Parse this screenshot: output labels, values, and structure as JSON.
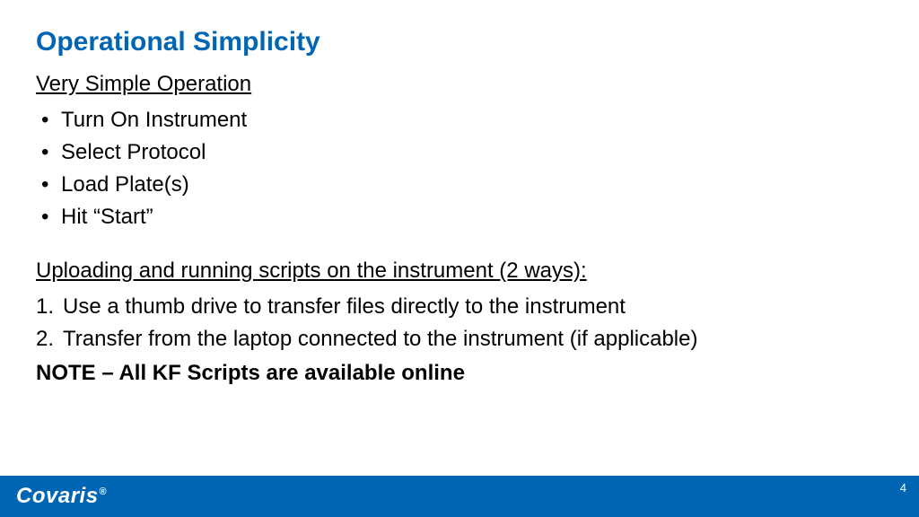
{
  "title": "Operational Simplicity",
  "section1": {
    "heading": "Very Simple Operation",
    "items": [
      "Turn On Instrument",
      "Select Protocol",
      "Load Plate(s)",
      "Hit “Start”"
    ]
  },
  "section2": {
    "heading": "Uploading and running scripts on the instrument (2 ways):",
    "items": [
      "Use a thumb drive to transfer files directly to the instrument",
      "Transfer from the laptop connected to the instrument (if applicable)"
    ]
  },
  "note": "NOTE – All KF Scripts are available online",
  "footer": {
    "brand": "Covaris",
    "brand_mark": "®",
    "page": "4"
  }
}
